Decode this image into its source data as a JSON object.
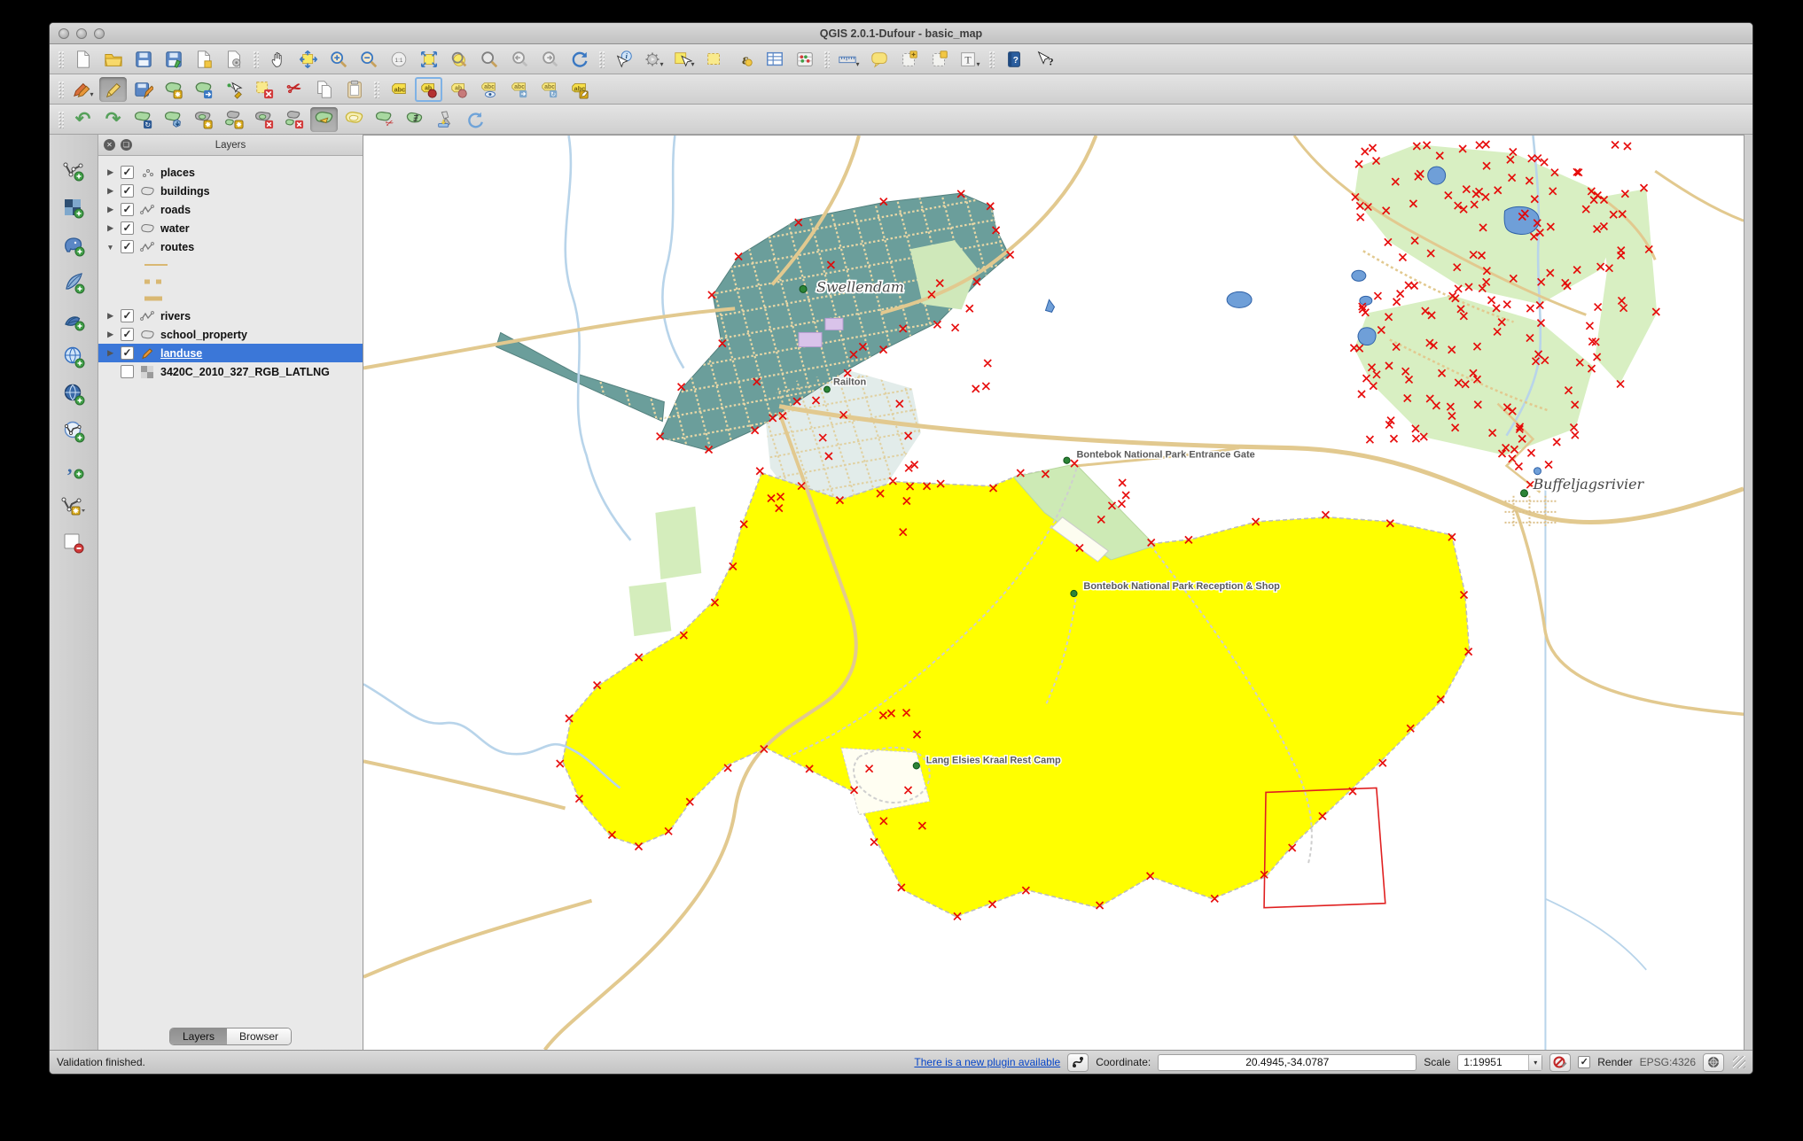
{
  "window": {
    "title": "QGIS 2.0.1-Dufour - basic_map"
  },
  "glyphs": {
    "check": "✓",
    "close": "✕",
    "dropdown": "▾",
    "collapsed": "▶",
    "expanded": "▼",
    "one_to_one": "1:1",
    "identify": "i",
    "expression": "ε",
    "label": "abc",
    "label_short": "ab",
    "text_annotation": "T",
    "help": "?",
    "whats_this": "?",
    "scissors": "✂",
    "undo": "↶",
    "redo": "↷",
    "rotate": "↻",
    "comma": ","
  },
  "toolbar_icon_names": {
    "row1": [
      "new-project",
      "open-project",
      "save-project",
      "save-project-as",
      "new-composer",
      "composer-manager",
      "pan-map",
      "pan-to-selection",
      "zoom-in",
      "zoom-out",
      "zoom-native",
      "zoom-full",
      "zoom-to-selection",
      "zoom-to-layer",
      "zoom-last",
      "zoom-next",
      "refresh",
      "identify",
      "run-feature-action",
      "select-features",
      "deselect-all",
      "select-by-expression",
      "open-attribute-table",
      "field-calculator",
      "measure",
      "map-tips",
      "new-bookmark",
      "show-bookmarks",
      "text-annotation",
      "help-contents",
      "whats-this"
    ],
    "row2": [
      "current-edits",
      "toggle-editing",
      "save-layer-edits",
      "add-feature",
      "move-feature",
      "node-tool",
      "delete-selected",
      "cut-features",
      "copy-features",
      "paste-features",
      "layer-labeling",
      "pin-labels",
      "highlight-pinned-labels",
      "show-hide-labels",
      "move-label",
      "rotate-label",
      "change-label"
    ],
    "row3": [
      "undo",
      "redo",
      "rotate-feature",
      "simplify-feature",
      "add-ring",
      "add-part",
      "delete-ring",
      "delete-part",
      "reshape-features",
      "offset-curve",
      "split-features",
      "split-parts",
      "merge-features",
      "rotate-point-symbols"
    ],
    "left_rail": [
      "add-vector-layer",
      "add-raster-layer",
      "add-postgis-layer",
      "add-spatialite-layer",
      "add-mssql-layer",
      "add-wms-layer",
      "add-wcs-layer",
      "add-wfs-layer",
      "add-delimited-text-layer",
      "new-shapefile-layer",
      "remove-layer"
    ]
  },
  "panel": {
    "title": "Layers",
    "tabs": {
      "layers": "Layers",
      "browser": "Browser"
    },
    "layers": [
      {
        "name": "places",
        "checked": true
      },
      {
        "name": "buildings",
        "checked": true
      },
      {
        "name": "roads",
        "checked": true
      },
      {
        "name": "water",
        "checked": true
      },
      {
        "name": "routes",
        "checked": true,
        "expanded": true
      },
      {
        "name": "rivers",
        "checked": true
      },
      {
        "name": "school_property",
        "checked": true
      },
      {
        "name": "landuse",
        "checked": true,
        "selected": true,
        "editing": true
      },
      {
        "name": "3420C_2010_327_RGB_LATLNG",
        "checked": false
      }
    ]
  },
  "map": {
    "labels": {
      "swellendam": "Swellendam",
      "railton": "Railton",
      "entrance_gate": "Bontebok National Park Entrance Gate",
      "reception_shop": "Bontebok National Park Reception & Shop",
      "rest_camp": "Lang Elsies Kraal Rest Camp",
      "buffeljagsrivier": "Buffeljagsrivier"
    },
    "colors": {
      "landuse_fill": "#ffff00",
      "urban_fill": "#6b9e9b",
      "park_fill": "#d8efc2",
      "vertex_marker": "#e60000",
      "road": "#e2c98f",
      "river": "#b8d4ea",
      "selection_blue": "#3b77d8"
    }
  },
  "statusbar": {
    "message": "Validation finished.",
    "plugin_link": "There is a new plugin available",
    "coordinate_label": "Coordinate:",
    "coordinate_value": "20.4945,-34.0787",
    "scale_label": "Scale",
    "scale_value": "1:19951",
    "render_label": "Render",
    "crs_label": "EPSG:4326"
  }
}
